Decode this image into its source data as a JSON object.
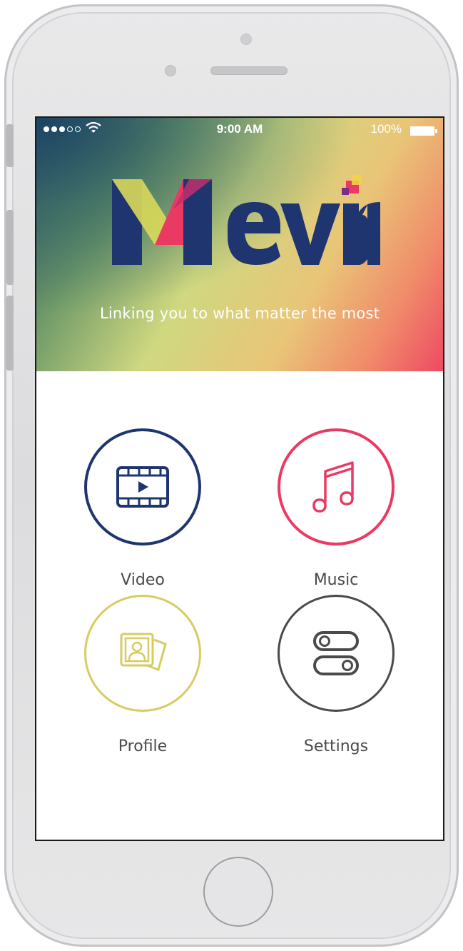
{
  "status_bar": {
    "time": "9:00 AM",
    "battery": "100%",
    "icons": [
      "signal-dots-icon",
      "wifi-icon",
      "battery-icon"
    ]
  },
  "app": {
    "tagline": "Linking you to  what matter the most"
  },
  "menu": {
    "items": [
      {
        "label": "Video",
        "icon": "video-icon",
        "color": "#1e3570"
      },
      {
        "label": "Music",
        "icon": "music-note-icon",
        "color": "#ea3a64"
      },
      {
        "label": "Profile",
        "icon": "profile-icon",
        "color": "#d6cc60"
      },
      {
        "label": "Settings",
        "icon": "toggle-settings-icon",
        "color": "#4a4a4a"
      }
    ]
  },
  "colors": {
    "brand_navy": "#1e3570",
    "brand_pink": "#ea3a64",
    "brand_yellow": "#d6cc60",
    "text_gray": "#4a4a4a"
  }
}
